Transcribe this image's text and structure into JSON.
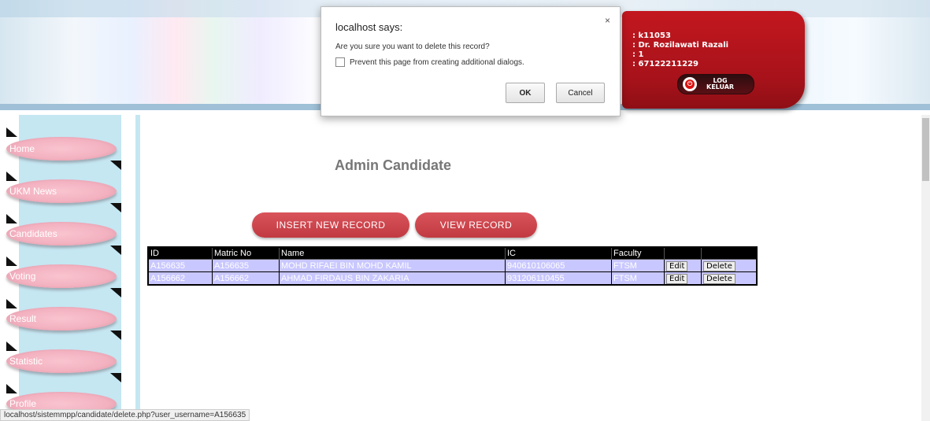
{
  "user": {
    "line1": ": k11053",
    "line2": ": Dr. Rozilawati Razali",
    "line3": ": 1",
    "line4": ": 67122211229",
    "logout_line1": "LOG",
    "logout_line2": "KELUAR"
  },
  "nav": [
    "Home",
    "UKM News",
    "Candidates",
    "Voting",
    "Result",
    "Statistic",
    "Profile"
  ],
  "page": {
    "title": "Admin Candidate",
    "insert_label": "INSERT NEW RECORD",
    "view_label": "VIEW RECORD"
  },
  "table": {
    "headers": [
      "ID",
      "Matric No",
      "Name",
      "IC",
      "Faculty",
      "",
      ""
    ],
    "rows": [
      {
        "id": "A156635",
        "matric": "A156635",
        "name": "MOHD RIFAEI BIN MOHD KAMIL",
        "ic": "940610106065",
        "faculty": "FTSM",
        "edit": "Edit",
        "delete": "Delete"
      },
      {
        "id": "A156662",
        "matric": "A156662",
        "name": "AHMAD FIRDAUS BIN ZAKARIA",
        "ic": "931206110455",
        "faculty": "FTSM",
        "edit": "Edit",
        "delete": "Delete"
      }
    ]
  },
  "dialog": {
    "title": "localhost says:",
    "close": "×",
    "message": "Are you sure you want to delete this record?",
    "checkbox_label": "Prevent this page from creating additional dialogs.",
    "ok_label": "OK",
    "cancel_label": "Cancel"
  },
  "status_url": "localhost/sistemmpp/candidate/delete.php?user_username=A156635",
  "colors": {
    "accent": "#c13a42",
    "nav_pink": "#f3b1c0",
    "table_row": "#c9c7ff"
  }
}
